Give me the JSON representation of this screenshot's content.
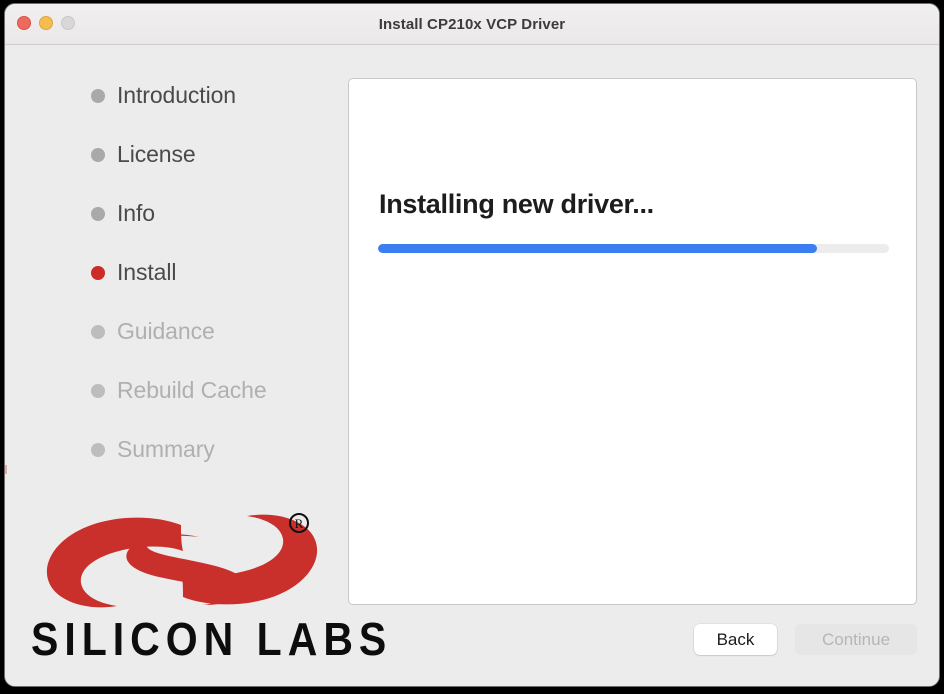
{
  "window": {
    "title": "Install CP210x VCP Driver",
    "traffic_lights": [
      {
        "name": "close",
        "color": "#ee6a5f"
      },
      {
        "name": "minimize",
        "color": "#f5bd4f"
      },
      {
        "name": "zoom",
        "color": "#d8d8d8"
      }
    ]
  },
  "sidebar": {
    "steps": [
      {
        "label": "Introduction",
        "state": "done"
      },
      {
        "label": "License",
        "state": "done"
      },
      {
        "label": "Info",
        "state": "done"
      },
      {
        "label": "Install",
        "state": "current"
      },
      {
        "label": "Guidance",
        "state": "upcoming"
      },
      {
        "label": "Rebuild Cache",
        "state": "upcoming"
      },
      {
        "label": "Summary",
        "state": "upcoming"
      }
    ],
    "logo": {
      "wordmark": "SILICON LABS",
      "registered_mark": "®",
      "brand_color": "#c9302c"
    }
  },
  "main": {
    "heading": "Installing new driver...",
    "progress": {
      "percent": 86,
      "fill_color": "#3b7ef2",
      "track_color": "#ececec"
    }
  },
  "footer": {
    "back_label": "Back",
    "continue_label": "Continue",
    "continue_disabled": true
  },
  "colors": {
    "accent_red": "#cc2b28",
    "accent_blue": "#3b7ef2",
    "window_bg": "#ececec",
    "panel_bg": "#ffffff"
  }
}
